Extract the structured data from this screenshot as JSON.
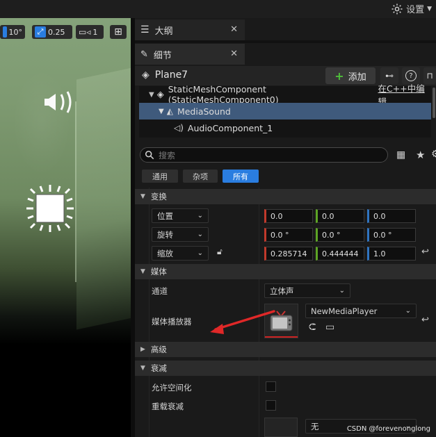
{
  "topbar": {
    "settings_label": "设置"
  },
  "viewport": {
    "angle_snap": "10°",
    "scale_snap": "0.25",
    "camera_speed": "1"
  },
  "panel_tabs": {
    "outliner": "大纲",
    "details": "细节"
  },
  "details": {
    "object_name": "Plane7",
    "add_button": "添加",
    "components": [
      {
        "label": "StaticMeshComponent (StaticMeshComponent0)",
        "suffix": "在C++中编辑"
      },
      {
        "label": "MediaSound"
      },
      {
        "label": "AudioComponent_1"
      }
    ],
    "search_placeholder": "搜索",
    "filters": {
      "general": "通用",
      "misc": "杂项",
      "all": "所有"
    },
    "sections": {
      "transform": "变换",
      "media": "媒体",
      "advanced": "高级",
      "attenuation": "衰减"
    },
    "transform": {
      "location": {
        "label": "位置",
        "x": "0.0",
        "y": "0.0",
        "z": "0.0"
      },
      "rotation": {
        "label": "旋转",
        "x": "0.0 °",
        "y": "0.0 °",
        "z": "0.0 °"
      },
      "scale": {
        "label": "缩放",
        "x": "0.285714",
        "y": "0.444444",
        "z": "1.0"
      }
    },
    "media": {
      "channel_label": "通道",
      "channel_value": "立体声",
      "player_label": "媒体播放器",
      "player_value": "NewMediaPlayer"
    },
    "attenuation": {
      "allow_spatialization": "允许空间化",
      "override_attenuation": "重载衰减",
      "dropdown_value": "无"
    }
  },
  "watermark": "CSDN @forevenonglong",
  "colors": {
    "accent_blue": "#2a7de0",
    "selected_row": "#3f5a7c",
    "annotation_arrow": "#e02828"
  }
}
